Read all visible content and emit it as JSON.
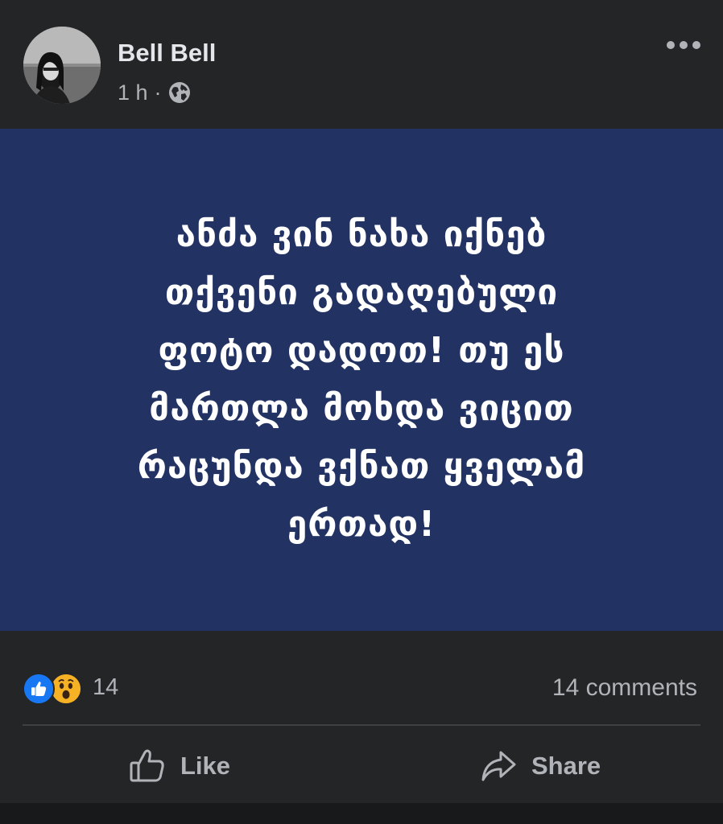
{
  "post": {
    "author": "Bell Bell",
    "time": "1 h",
    "separator": "·",
    "privacy_icon": "globe-icon",
    "more_icon": "more-options-icon",
    "text": "ანძა ვინ ნახა იქნებ\nთქვენი გადაღებული\nფოტო დადოთ! თუ ეს\nმართლა მოხდა ვიცით\nრაცუნდა ვქნათ ყველამ\nერთად!",
    "background_color": "#223363"
  },
  "stats": {
    "reactions": [
      "like-reaction-icon",
      "wow-reaction-icon"
    ],
    "reaction_count": "14",
    "comments": "14 comments"
  },
  "actions": {
    "like_label": "Like",
    "share_label": "Share"
  }
}
